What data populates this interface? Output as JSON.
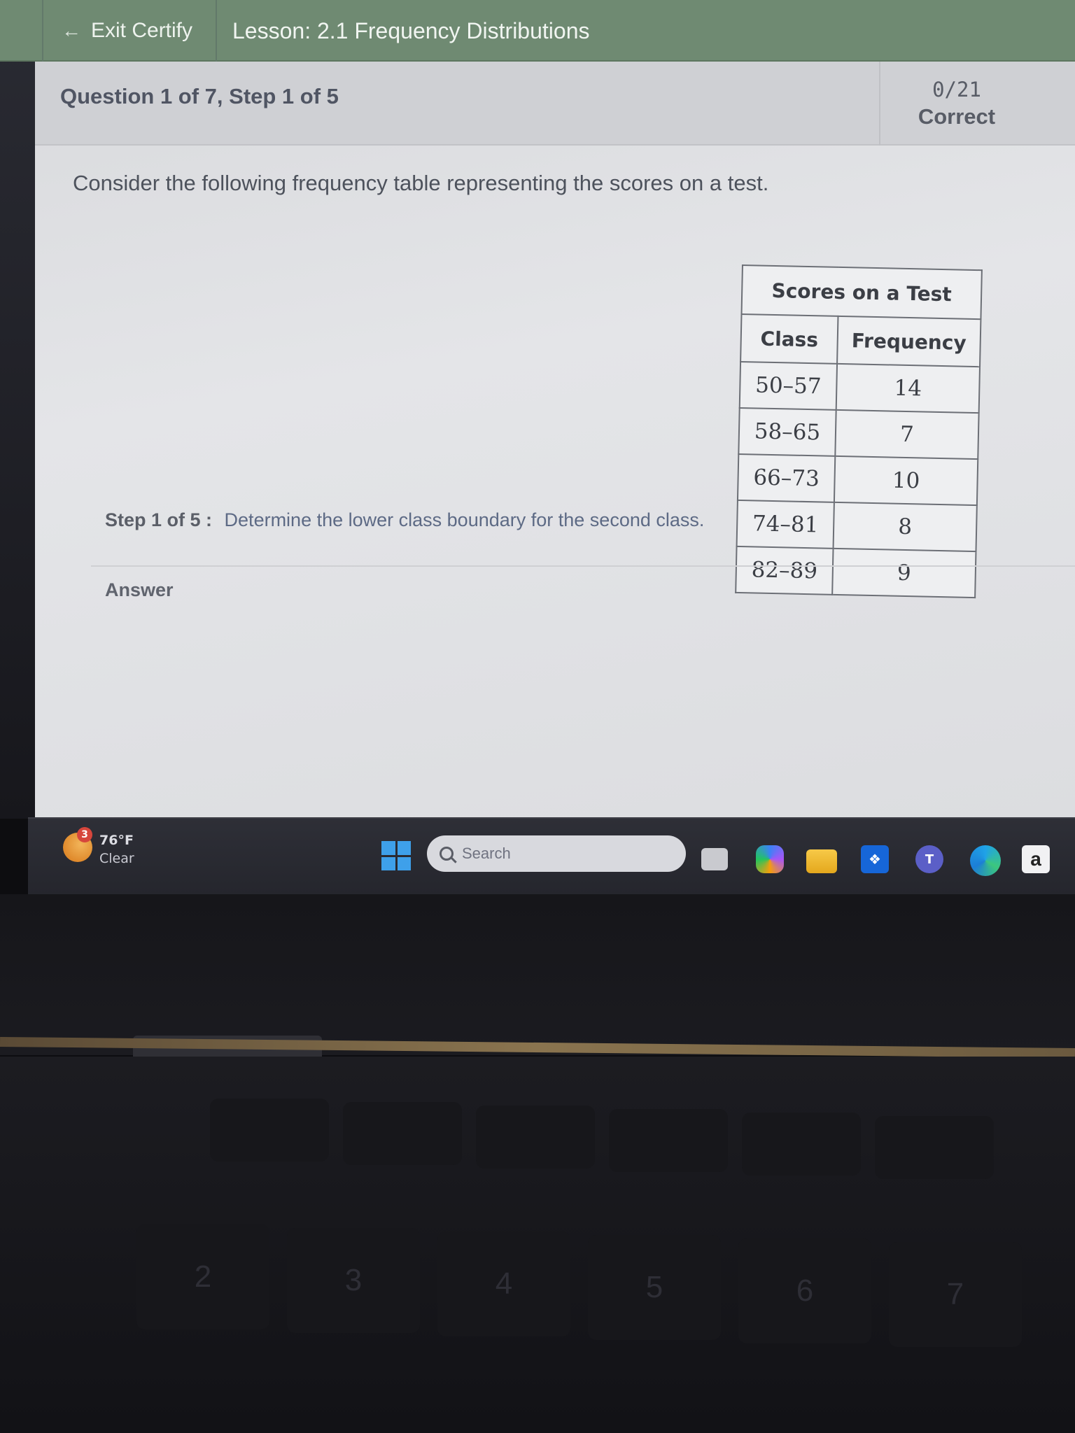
{
  "topbar": {
    "exit_label": "Exit Certify",
    "lesson_title": "Lesson: 2.1 Frequency Distributions"
  },
  "header": {
    "question_progress": "Question 1 of 7, Step 1 of 5",
    "score_count": "0/21",
    "score_label": "Correct"
  },
  "question": {
    "prompt": "Consider the following frequency table representing the scores on a test."
  },
  "table": {
    "caption": "Scores on a Test",
    "headers": [
      "Class",
      "Frequency"
    ],
    "rows": [
      [
        "50–57",
        "14"
      ],
      [
        "58–65",
        "7"
      ],
      [
        "66–73",
        "10"
      ],
      [
        "74–81",
        "8"
      ],
      [
        "82–89",
        "9"
      ]
    ]
  },
  "step": {
    "label": "Step 1 of 5 :",
    "text": "Determine the lower class boundary for the second class."
  },
  "answer": {
    "label": "Answer"
  },
  "taskbar": {
    "weather_badge": "3",
    "weather_temp": "76°F",
    "weather_condition": "Clear",
    "search_placeholder": "Search",
    "amazon_letter": "a"
  },
  "keyboard": {
    "keys": [
      "@",
      "2",
      "#",
      "3",
      "$",
      "4",
      "%",
      "5",
      "^",
      "6",
      "&",
      "7"
    ]
  },
  "colors": {
    "topbar": "#6f8a72",
    "content_bg": "#e2e3e6",
    "start_blue": "#3ea0ea"
  }
}
